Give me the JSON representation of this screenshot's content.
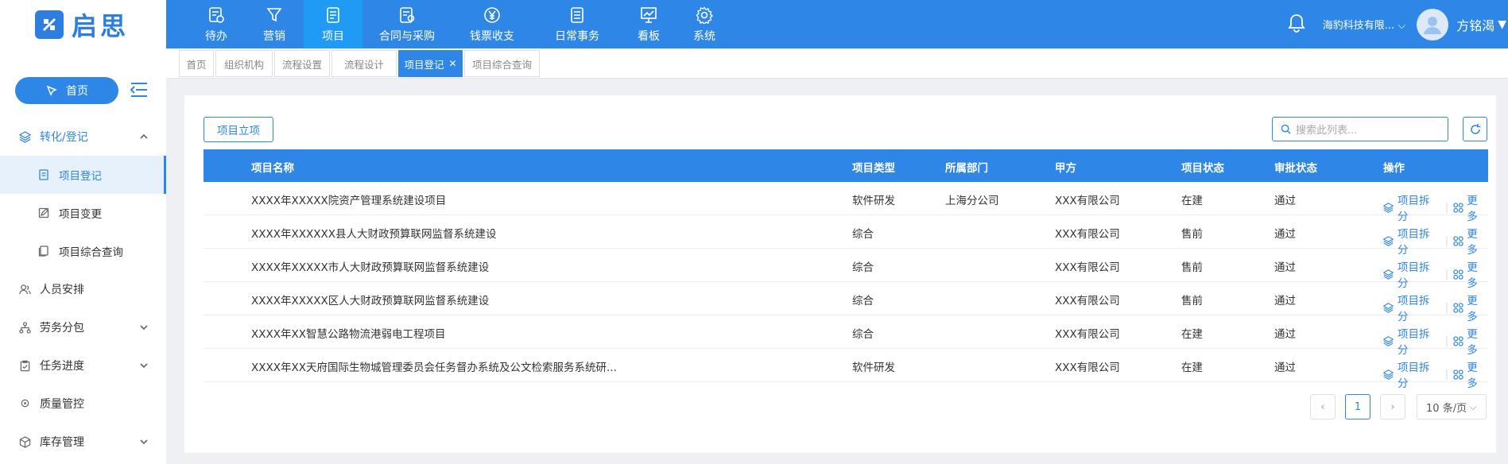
{
  "brand": {
    "name": "启思",
    "color": "#2e86e6"
  },
  "nav": [
    {
      "label": "待办",
      "icon": "todo-icon"
    },
    {
      "label": "营销",
      "icon": "funnel-icon"
    },
    {
      "label": "项目",
      "icon": "project-icon",
      "active": true
    },
    {
      "label": "合同与采购",
      "icon": "contract-icon"
    },
    {
      "label": "钱票收支",
      "icon": "yuan-icon"
    },
    {
      "label": "日常事务",
      "icon": "list-icon"
    },
    {
      "label": "看板",
      "icon": "board-icon"
    },
    {
      "label": "系统",
      "icon": "gear-icon"
    }
  ],
  "user": {
    "company": "海豹科技有限...",
    "name": "方铭渴"
  },
  "sidebar": {
    "home_label": "首页",
    "items": [
      {
        "label": "转化/登记",
        "icon": "layers-icon"
      },
      {
        "label": "项目登记",
        "icon": "doc-icon"
      },
      {
        "label": "项目变更",
        "icon": "edit-icon"
      },
      {
        "label": "项目综合查询",
        "icon": "files-icon"
      },
      {
        "label": "人员安排",
        "icon": "people-icon"
      },
      {
        "label": "劳务分包",
        "icon": "org-icon"
      },
      {
        "label": "任务进度",
        "icon": "clipboard-icon"
      },
      {
        "label": "质量管控",
        "icon": "badge-icon"
      },
      {
        "label": "库存管理",
        "icon": "box-icon"
      }
    ]
  },
  "tabs": [
    "首页",
    "组织机构",
    "流程设置",
    "流程设计",
    "项目登记",
    "项目综合查询"
  ],
  "toolbar": {
    "new_label": "项目立项",
    "search_placeholder": "搜索此列表..."
  },
  "table": {
    "headers": [
      "项目名称",
      "项目类型",
      "所属部门",
      "甲方",
      "项目状态",
      "审批状态",
      "操作"
    ],
    "rows": [
      [
        "XXXX年XXXXX院资产管理系统建设项目",
        "软件研发",
        "上海分公司",
        "XXX有限公司",
        "在建",
        "通过"
      ],
      [
        "XXXX年XXXXXX县人大财政预算联网监督系统建设",
        "综合",
        "",
        "XXX有限公司",
        "售前",
        "通过"
      ],
      [
        "XXXX年XXXXX市人大财政预算联网监督系统建设",
        "综合",
        "",
        "XXX有限公司",
        "售前",
        "通过"
      ],
      [
        "XXXX年XXXXX区人大财政预算联网监督系统建设",
        "综合",
        "",
        "XXX有限公司",
        "售前",
        "通过"
      ],
      [
        "XXXX年XX智慧公路物流港弱电工程项目",
        "综合",
        "",
        "XXX有限公司",
        "在建",
        "通过"
      ],
      [
        "XXXX年XX天府国际生物城管理委员会任务督办系统及公文检索服务系统研...",
        "软件研发",
        "",
        "XXX有限公司",
        "在建",
        "通过"
      ]
    ],
    "action_split": "项目拆分",
    "action_more": "更多"
  },
  "pager": {
    "current": "1",
    "size": "10 条/页"
  }
}
